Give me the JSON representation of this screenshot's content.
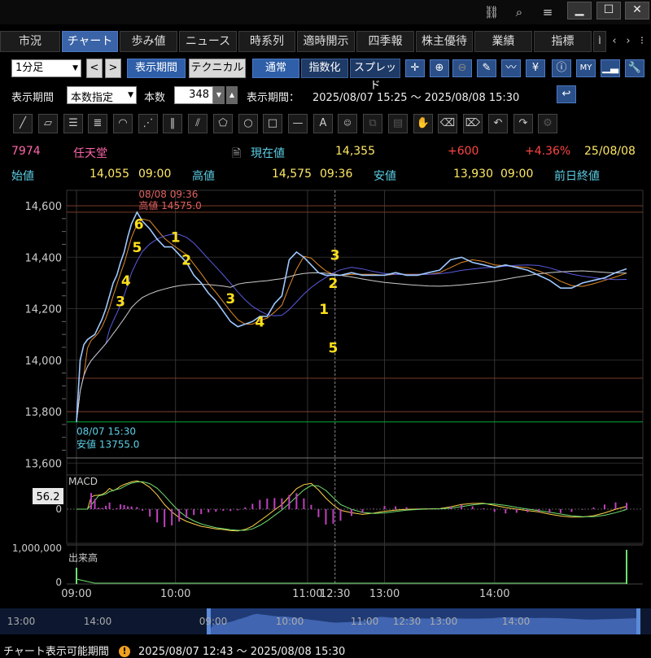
{
  "window": {
    "icons": [
      "link-icon",
      "search-icon",
      "menu-icon"
    ],
    "min": "▁",
    "max": "☐",
    "close": "✕"
  },
  "tabs": [
    {
      "label": "市況",
      "active": false
    },
    {
      "label": "チャート",
      "active": true
    },
    {
      "label": "歩み値",
      "active": false
    },
    {
      "label": "ニュース",
      "active": false
    },
    {
      "label": "時系列",
      "active": false
    },
    {
      "label": "適時開示",
      "active": false
    },
    {
      "label": "四季報",
      "active": false
    },
    {
      "label": "株主優待",
      "active": false
    },
    {
      "label": "業績",
      "active": false
    },
    {
      "label": "指標",
      "active": false
    },
    {
      "label": "Ì",
      "active": false
    }
  ],
  "toolbar": {
    "interval": "1分足",
    "prev": "<",
    "next": ">",
    "period_btn": "表示期間",
    "technical_btn": "テクニカル",
    "normal_btn": "通常",
    "index_btn": "指数化",
    "spread_btn": "スプレッド"
  },
  "period_row": {
    "label": "表示期間",
    "mode": "本数指定",
    "count_label": "本数",
    "count": "348",
    "range_label": "表示期間：",
    "range": "2025/08/07 15:25 ～ 2025/08/08 15:30"
  },
  "quote": {
    "code": "7974",
    "name": "任天堂",
    "current_label": "現在値",
    "current": "14,355",
    "change": "+600",
    "change_pct": "+4.36%",
    "date": "25/08/08",
    "open_label": "始値",
    "open": "14,055",
    "open_time": "09:00",
    "high_label": "高値",
    "high": "14,575",
    "high_time": "09:36",
    "low_label": "安値",
    "low": "13,930",
    "low_time": "09:00",
    "prev_close_label": "前日終値"
  },
  "chart_data": {
    "type": "line",
    "y_ticks": [
      "14,600",
      "14,400",
      "14,200",
      "14,000",
      "13,800",
      "13,600"
    ],
    "y_values": [
      14600,
      14400,
      14200,
      14000,
      13800,
      13600
    ],
    "ylim": [
      13560,
      14660
    ],
    "x_ticks": [
      "09:00",
      "10:00",
      "11:00",
      "12:30",
      "13:00",
      "14:00"
    ],
    "high_annotation": {
      "time": "08/08 09:36",
      "label": "高値 14575.0"
    },
    "low_annotation": {
      "time": "08/07 15:30",
      "label": "安値 13755.0"
    },
    "price": {
      "t": [
        0,
        2,
        4,
        6,
        8,
        10,
        12,
        14,
        16,
        18,
        20,
        22,
        24,
        26,
        28,
        30,
        33,
        36,
        40,
        44,
        48,
        52,
        56,
        60,
        64,
        68,
        72,
        76,
        80,
        84,
        88,
        92,
        96,
        100,
        104,
        108,
        112,
        116,
        120,
        124,
        128,
        132,
        136,
        140,
        144,
        150,
        156,
        162,
        168,
        174,
        180,
        186,
        192,
        198,
        204,
        210,
        216,
        222,
        228,
        234,
        240,
        246,
        252,
        258,
        264,
        270,
        276,
        282,
        288,
        294,
        300
      ],
      "v": [
        13760,
        14000,
        14060,
        14080,
        14090,
        14100,
        14130,
        14160,
        14200,
        14250,
        14300,
        14330,
        14380,
        14420,
        14480,
        14530,
        14575,
        14540,
        14510,
        14470,
        14440,
        14440,
        14410,
        14380,
        14330,
        14300,
        14260,
        14230,
        14190,
        14150,
        14130,
        14140,
        14150,
        14170,
        14170,
        14220,
        14250,
        14390,
        14420,
        14400,
        14370,
        14340,
        14330,
        14330,
        14330,
        14340,
        14330,
        14330,
        14330,
        14340,
        14330,
        14330,
        14340,
        14350,
        14390,
        14400,
        14380,
        14370,
        14360,
        14370,
        14360,
        14350,
        14330,
        14310,
        14280,
        14280,
        14300,
        14310,
        14320,
        14340,
        14355
      ]
    },
    "horizontal_lines": [
      14600,
      14575,
      13930,
      13800,
      13760,
      13620
    ],
    "macd_label": "MACD",
    "macd_value": "56.2",
    "macd_zero": "0",
    "volume_label": "出来高",
    "volume_max": "1,000,000",
    "volume_zero": "0",
    "nav_ticks": [
      "13:00",
      "14:00",
      "09:00",
      "10:00",
      "11:00",
      "12:30",
      "13:00",
      "14:00"
    ],
    "wave_labels": [
      {
        "t": 24,
        "v": 14210,
        "text": "3"
      },
      {
        "t": 27,
        "v": 14290,
        "text": "4"
      },
      {
        "t": 33,
        "v": 14420,
        "text": "5"
      },
      {
        "t": 34,
        "v": 14510,
        "text": "6"
      },
      {
        "t": 54,
        "v": 14460,
        "text": "1"
      },
      {
        "t": 60,
        "v": 14370,
        "text": "2"
      },
      {
        "t": 84,
        "v": 14220,
        "text": "3"
      },
      {
        "t": 100,
        "v": 14130,
        "text": "4"
      },
      {
        "t": 135,
        "v": 14180,
        "text": "1"
      },
      {
        "t": 140,
        "v": 14280,
        "text": "2"
      },
      {
        "t": 141,
        "v": 14390,
        "text": "3"
      },
      {
        "t": 140,
        "v": 14030,
        "text": "5"
      }
    ]
  },
  "status": {
    "label": "チャート表示可能期間",
    "range": "2025/08/07 12:43 ～ 2025/08/08 15:30"
  },
  "colors": {
    "accent": "#3b64a8",
    "price": "#9ec8ff",
    "ma_short": "#e08a2a",
    "ma_long": "#5a5ae0",
    "ma_mid": "#cccccc"
  }
}
